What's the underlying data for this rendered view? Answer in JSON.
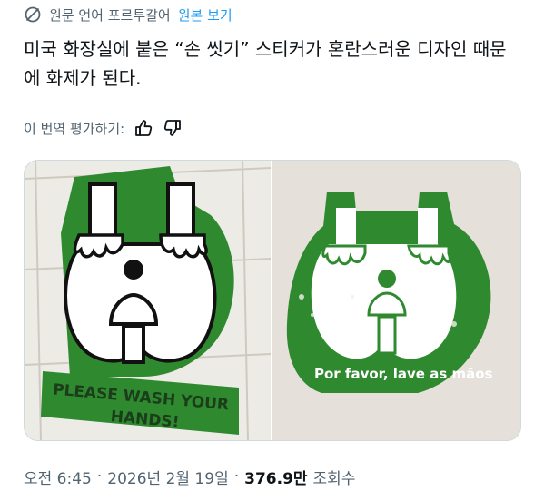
{
  "translation": {
    "source_label": "원문 언어 포르투갈어",
    "show_original": "원본 보기"
  },
  "tweet": {
    "text": "미국 화장실에 붙은 “손 씻기” 스티커가 혼란스러운 디자인 때문에 화제가 된다."
  },
  "rating": {
    "label": "이 번역 평가하기:"
  },
  "media": {
    "left_sign_text_line1": "PLEASE WASH YOUR",
    "left_sign_text_line2": "HANDS!",
    "right_sign_text": "Por favor, lave as mãos",
    "sign_color": "#2f8a2f"
  },
  "meta": {
    "time": "오전 6:45",
    "separator": "·",
    "date": "2026년 2월 19일",
    "views_count": "376.9만",
    "views_label": "조회수"
  },
  "icons": [
    "translate-icon",
    "thumbs-up-icon",
    "thumbs-down-icon"
  ]
}
